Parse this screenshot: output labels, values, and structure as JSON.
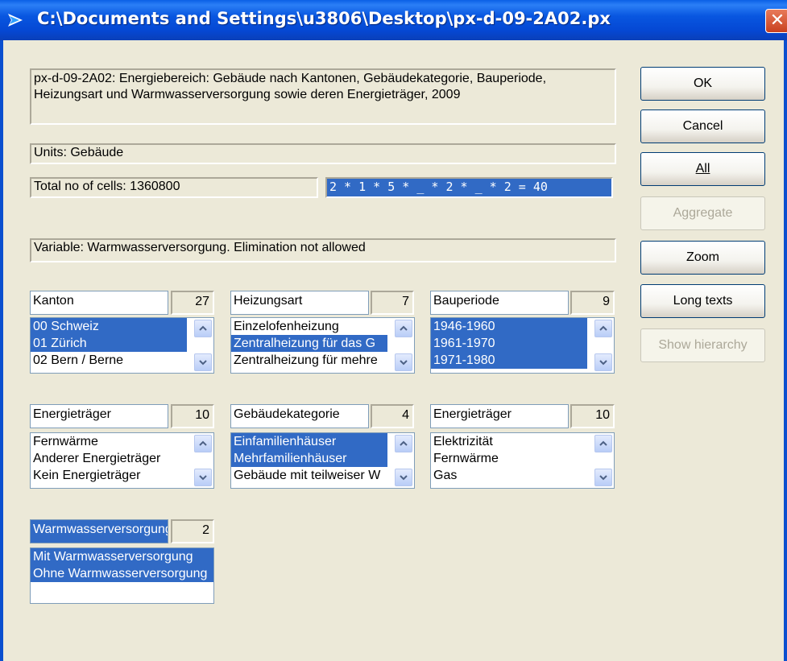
{
  "window": {
    "title": "C:\\Documents and Settings\\u3806\\Desktop\\px-d-09-2A02.px",
    "close_glyph": "✕"
  },
  "description": "px-d-09-2A02: Energiebereich: Gebäude nach Kantonen, Gebäudekategorie, Bauperiode, Heizungsart und Warmwasserversorgung sowie deren Energieträger, 2009",
  "units": "Units: Gebäude",
  "total_cells": "Total no of cells:  1360800",
  "selection_formula": "2 * 1 * 5 * _ * 2 * _ * 2 = 40",
  "variable_status": "Variable: Warmwasserversorgung. Elimination not allowed",
  "buttons": {
    "ok": "OK",
    "cancel": "Cancel",
    "all": "All",
    "aggregate": "Aggregate",
    "zoom": "Zoom",
    "long_texts": "Long texts",
    "show_hierarchy": "Show hierarchy"
  },
  "variables": [
    {
      "label": "Kanton",
      "count": "27",
      "items": [
        {
          "text": "00 Schweiz",
          "selected": true
        },
        {
          "text": "01 Zürich",
          "selected": true
        },
        {
          "text": "02 Bern / Berne",
          "selected": false
        }
      ]
    },
    {
      "label": "Heizungsart",
      "count": "7",
      "items": [
        {
          "text": "Einzelofenheizung",
          "selected": false
        },
        {
          "text": "Zentralheizung für das G",
          "selected": true
        },
        {
          "text": "Zentralheizung für mehre",
          "selected": false
        }
      ]
    },
    {
      "label": "Bauperiode",
      "count": "9",
      "items": [
        {
          "text": "1946-1960",
          "selected": true
        },
        {
          "text": "1961-1970",
          "selected": true
        },
        {
          "text": "1971-1980",
          "selected": true
        }
      ]
    },
    {
      "label": "Energieträger",
      "count": "10",
      "items": [
        {
          "text": "Fernwärme",
          "selected": false
        },
        {
          "text": "Anderer Energieträger",
          "selected": false
        },
        {
          "text": "Kein Energieträger",
          "selected": false
        }
      ]
    },
    {
      "label": "Gebäudekategorie",
      "count": "4",
      "items": [
        {
          "text": "Einfamilienhäuser",
          "selected": true
        },
        {
          "text": "Mehrfamilienhäuser",
          "selected": true
        },
        {
          "text": "Gebäude mit teilweiser W",
          "selected": false
        }
      ]
    },
    {
      "label": "Energieträger",
      "count": "10",
      "items": [
        {
          "text": "Elektrizität",
          "selected": false
        },
        {
          "text": "Fernwärme",
          "selected": false
        },
        {
          "text": "Gas",
          "selected": false
        }
      ]
    },
    {
      "label": "Warmwasserversorgung",
      "count": "2",
      "items": [
        {
          "text": "Mit Warmwasserversorgung",
          "selected": true
        },
        {
          "text": "Ohne Warmwasserversorgung",
          "selected": true
        }
      ]
    }
  ],
  "icons": {
    "app": "arrow-icon",
    "scroll_up": "chevron-up-icon",
    "scroll_down": "chevron-down-icon"
  },
  "colors": {
    "selection": "#316ac5",
    "titlebar": "#0856e0",
    "dialog": "#ece9d8"
  }
}
